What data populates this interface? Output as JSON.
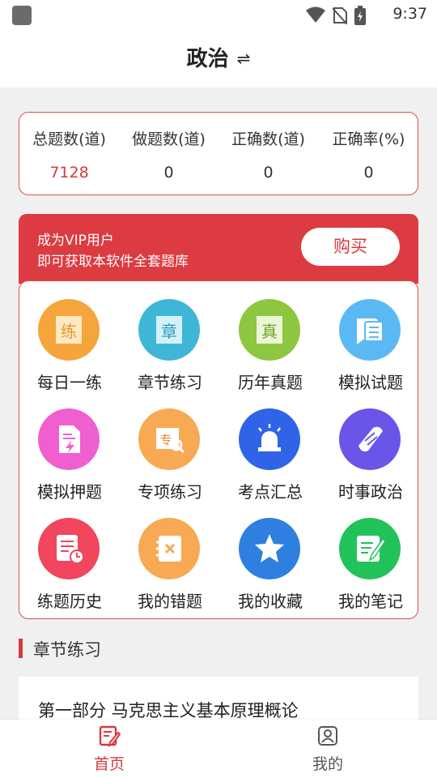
{
  "status_bar": {
    "time": "9:37",
    "icons": [
      "app-icon",
      "wifi-icon",
      "no-sim-icon",
      "battery-icon"
    ]
  },
  "header": {
    "title": "政治",
    "swap_icon": "⇌"
  },
  "stats": [
    {
      "label": "总题数(道)",
      "value": "7128"
    },
    {
      "label": "做题数(道)",
      "value": "0"
    },
    {
      "label": "正确数(道)",
      "value": "0"
    },
    {
      "label": "正确率(%)",
      "value": "0"
    }
  ],
  "vip": {
    "line1": "成为VIP用户",
    "line2": "即可获取本软件全套题库",
    "buy_label": "购买"
  },
  "grid": [
    {
      "label": "每日一练",
      "icon": "daily-practice-icon",
      "glyph": "练",
      "color": "#f5a53b"
    },
    {
      "label": "章节练习",
      "icon": "chapter-practice-icon",
      "glyph": "章",
      "color": "#3fb6d6"
    },
    {
      "label": "历年真题",
      "icon": "past-exams-icon",
      "glyph": "真",
      "color": "#8dc63f"
    },
    {
      "label": "模拟试题",
      "icon": "mock-exam-icon",
      "glyph": "",
      "color": "#5ab9f3"
    },
    {
      "label": "模拟押题",
      "icon": "predicted-questions-icon",
      "glyph": "",
      "color": "#f05fd0"
    },
    {
      "label": "专项练习",
      "icon": "special-practice-icon",
      "glyph": "专",
      "color": "#f8a953"
    },
    {
      "label": "考点汇总",
      "icon": "key-points-icon",
      "glyph": "",
      "color": "#2f63e8"
    },
    {
      "label": "时事政治",
      "icon": "current-affairs-icon",
      "glyph": "",
      "color": "#6a55e9"
    },
    {
      "label": "练题历史",
      "icon": "practice-history-icon",
      "glyph": "",
      "color": "#f2455e"
    },
    {
      "label": "我的错题",
      "icon": "my-mistakes-icon",
      "glyph": "",
      "color": "#f8a953"
    },
    {
      "label": "我的收藏",
      "icon": "my-favorites-icon",
      "glyph": "",
      "color": "#2f7fe0"
    },
    {
      "label": "我的笔记",
      "icon": "my-notes-icon",
      "glyph": "",
      "color": "#22c25a"
    }
  ],
  "section": {
    "title": "章节练习"
  },
  "chapters": [
    {
      "title": "第一部分 马克思主义基本原理概论"
    }
  ],
  "tabs": [
    {
      "label": "首页",
      "icon": "home-edit-icon",
      "active": true,
      "color": "#d9393e"
    },
    {
      "label": "我的",
      "icon": "profile-icon",
      "active": false,
      "color": "#555555"
    }
  ]
}
